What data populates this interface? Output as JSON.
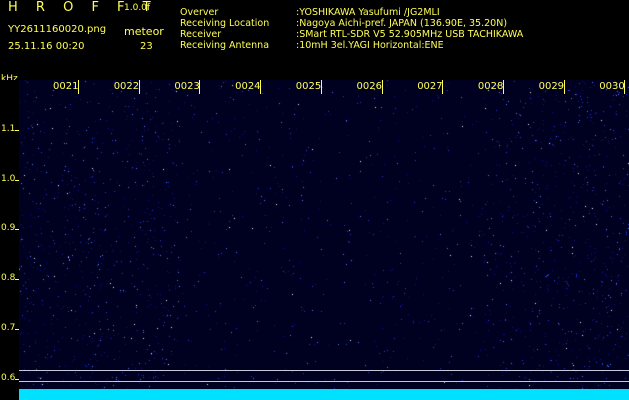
{
  "header": {
    "brand": "H R O F F T",
    "version": "1.0.0f",
    "filename": "YY2611160020.png",
    "meteor_label": "meteor",
    "datetime": "25.11.16 00:20",
    "meteor_count": "23",
    "info": [
      {
        "label": "Overver",
        "value": ":YOSHIKAWA Yasufumi /JG2MLI"
      },
      {
        "label": "Receiving Location",
        "value": ":Nagoya Aichi-pref. JAPAN (136.90E, 35.20N)"
      },
      {
        "label": "Receiver",
        "value": ":SMart RTL-SDR V5 52.905MHz USB TACHIKAWA"
      },
      {
        "label": "Receiving Antenna",
        "value": ":10mH 3el.YAGI Horizontal:ENE"
      }
    ]
  },
  "axis": {
    "unit": "kHz",
    "y_labels": [
      "1.1",
      "1.0",
      "0.9",
      "0.8",
      "0.7",
      "0.6"
    ],
    "x_labels": [
      "0021",
      "0022",
      "0023",
      "0024",
      "0025",
      "0026",
      "0027",
      "0028",
      "0029",
      "0030"
    ]
  },
  "colors": {
    "text": "#ffff55",
    "background": "#000000",
    "noise_bright": "#3a4cff",
    "noise_dark": "#0a0a60",
    "floor": "#00e0ff"
  }
}
